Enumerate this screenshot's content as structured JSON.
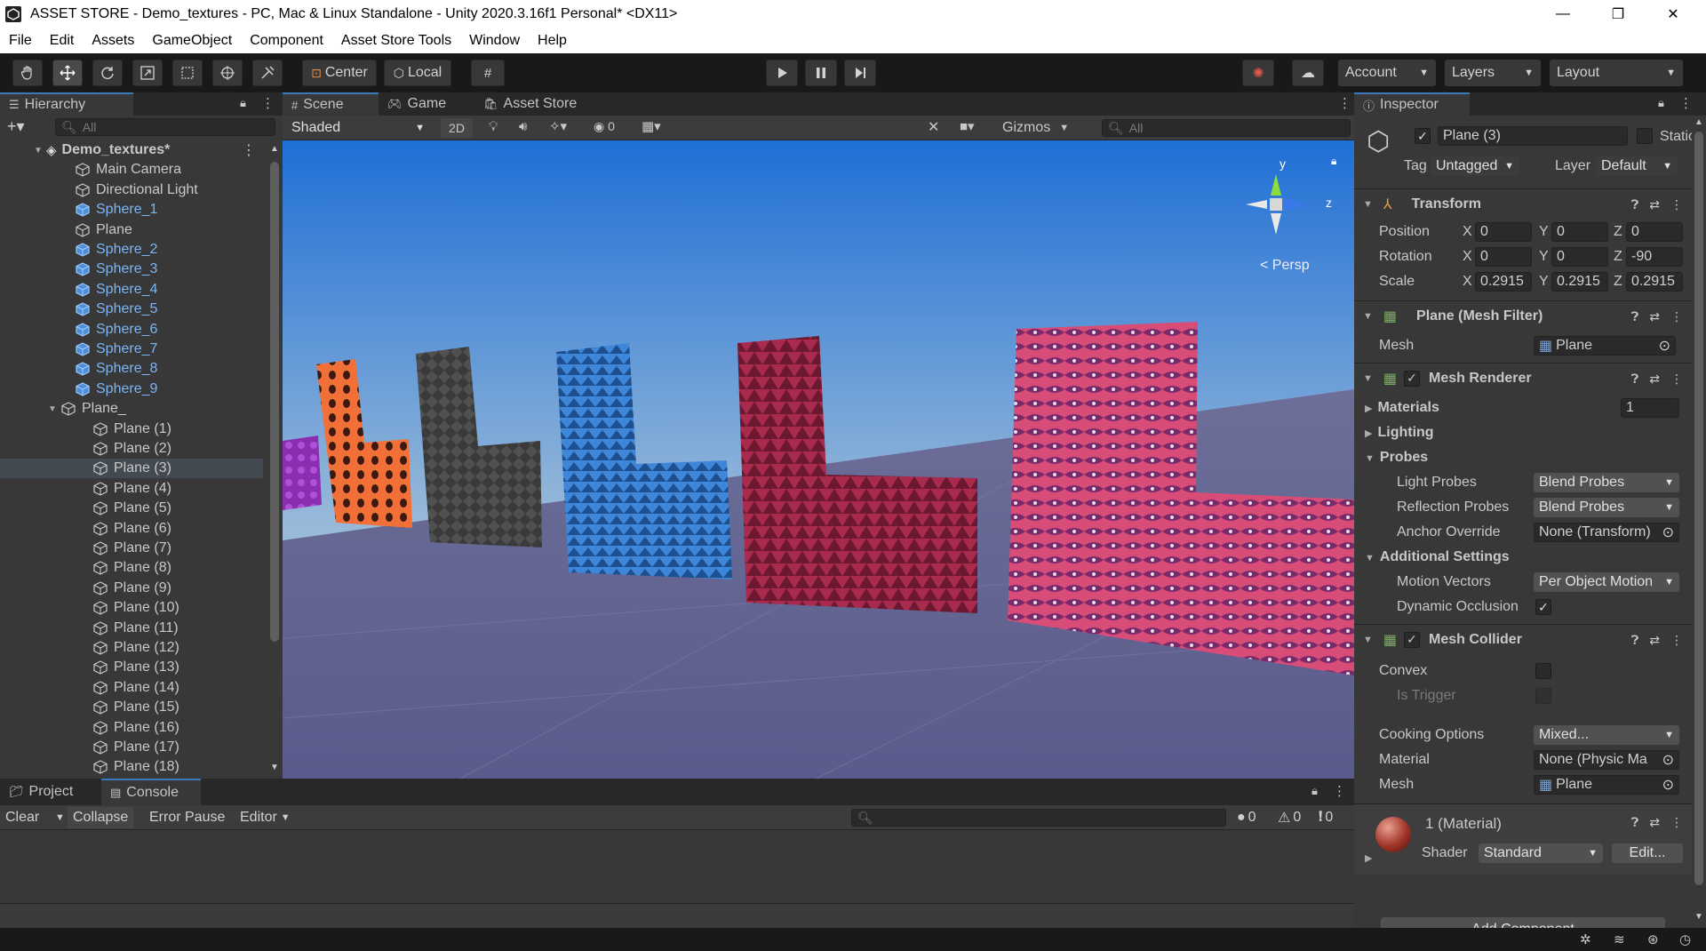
{
  "window": {
    "title": "ASSET STORE - Demo_textures - PC, Mac & Linux Standalone - Unity 2020.3.16f1 Personal* <DX11>",
    "controls": [
      "—",
      "❐",
      "✕"
    ]
  },
  "menu": [
    "File",
    "Edit",
    "Assets",
    "GameObject",
    "Component",
    "Asset Store Tools",
    "Window",
    "Help"
  ],
  "toolbar": {
    "pivot_label": "Center",
    "space_label": "Local",
    "account_label": "Account",
    "layers_label": "Layers",
    "layout_label": "Layout"
  },
  "hierarchy": {
    "tab": "Hierarchy",
    "search_placeholder": "All",
    "scene_name": "Demo_textures*",
    "items": [
      {
        "label": "Main Camera",
        "prefab": false
      },
      {
        "label": "Directional Light",
        "prefab": false
      },
      {
        "label": "Sphere_1",
        "prefab": true
      },
      {
        "label": "Plane",
        "prefab": false
      },
      {
        "label": "Sphere_2",
        "prefab": true
      },
      {
        "label": "Sphere_3",
        "prefab": true
      },
      {
        "label": "Sphere_4",
        "prefab": true
      },
      {
        "label": "Sphere_5",
        "prefab": true
      },
      {
        "label": "Sphere_6",
        "prefab": true
      },
      {
        "label": "Sphere_7",
        "prefab": true
      },
      {
        "label": "Sphere_8",
        "prefab": true
      },
      {
        "label": "Sphere_9",
        "prefab": true
      }
    ],
    "parent_label": "Plane_",
    "children": [
      "Plane (1)",
      "Plane (2)",
      "Plane (3)",
      "Plane (4)",
      "Plane (5)",
      "Plane (6)",
      "Plane (7)",
      "Plane (8)",
      "Plane (9)",
      "Plane (10)",
      "Plane (11)",
      "Plane (12)",
      "Plane (13)",
      "Plane (14)",
      "Plane (15)",
      "Plane (16)",
      "Plane (17)",
      "Plane (18)"
    ],
    "selected_child": "Plane (3)"
  },
  "scene": {
    "tabs": [
      "Scene",
      "Game",
      "Asset Store"
    ],
    "draw_mode": "Shaded",
    "mode_2d": "2D",
    "hidden_count": "0",
    "gizmos_label": "Gizmos",
    "search_placeholder": "All",
    "persp_label": "< Persp",
    "axis_y": "y",
    "axis_z": "z",
    "wall_colors": [
      "#8a2fb0",
      "#f07038",
      "#505050",
      "#3d86d8",
      "#a82a4c",
      "#d84c78"
    ]
  },
  "inspector": {
    "tab": "Inspector",
    "object_name": "Plane (3)",
    "static_label": "Static",
    "tag_label": "Tag",
    "tag_value": "Untagged",
    "layer_label": "Layer",
    "layer_value": "Default",
    "transform": {
      "title": "Transform",
      "position_label": "Position",
      "rotation_label": "Rotation",
      "scale_label": "Scale",
      "position": {
        "x": "0",
        "y": "0",
        "z": "0"
      },
      "rotation": {
        "x": "0",
        "y": "0",
        "z": "-90"
      },
      "scale": {
        "x": "0.2915",
        "y": "0.2915",
        "z": "0.2915"
      }
    },
    "mesh_filter": {
      "title": "Plane (Mesh Filter)",
      "mesh_label": "Mesh",
      "mesh_value": "Plane"
    },
    "mesh_renderer": {
      "title": "Mesh Renderer",
      "materials_label": "Materials",
      "materials_count": "1",
      "lighting_label": "Lighting",
      "probes_label": "Probes",
      "light_probes_label": "Light Probes",
      "light_probes_value": "Blend Probes",
      "reflection_probes_label": "Reflection Probes",
      "reflection_probes_value": "Blend Probes",
      "anchor_override_label": "Anchor Override",
      "anchor_override_value": "None (Transform)",
      "additional_label": "Additional Settings",
      "motion_vectors_label": "Motion Vectors",
      "motion_vectors_value": "Per Object Motion",
      "dynamic_occlusion_label": "Dynamic Occlusion"
    },
    "mesh_collider": {
      "title": "Mesh Collider",
      "convex_label": "Convex",
      "is_trigger_label": "Is Trigger",
      "cooking_label": "Cooking Options",
      "cooking_value": "Mixed...",
      "material_label": "Material",
      "material_value": "None (Physic Ma",
      "mesh_label": "Mesh",
      "mesh_value": "Plane"
    },
    "material": {
      "title": "1 (Material)",
      "shader_label": "Shader",
      "shader_value": "Standard",
      "edit_label": "Edit...",
      "add_component_label": "Add Component"
    }
  },
  "console": {
    "tabs": [
      "Project",
      "Console"
    ],
    "clear_label": "Clear",
    "collapse_label": "Collapse",
    "error_pause_label": "Error Pause",
    "editor_label": "Editor",
    "log_count": "0",
    "warn_count": "0",
    "error_count": "0"
  },
  "colors": {
    "accent": "#3a79bb",
    "prefab_blue": "#7cb6f4",
    "panel_bg": "#383838",
    "toolbar_bg": "#191919"
  }
}
